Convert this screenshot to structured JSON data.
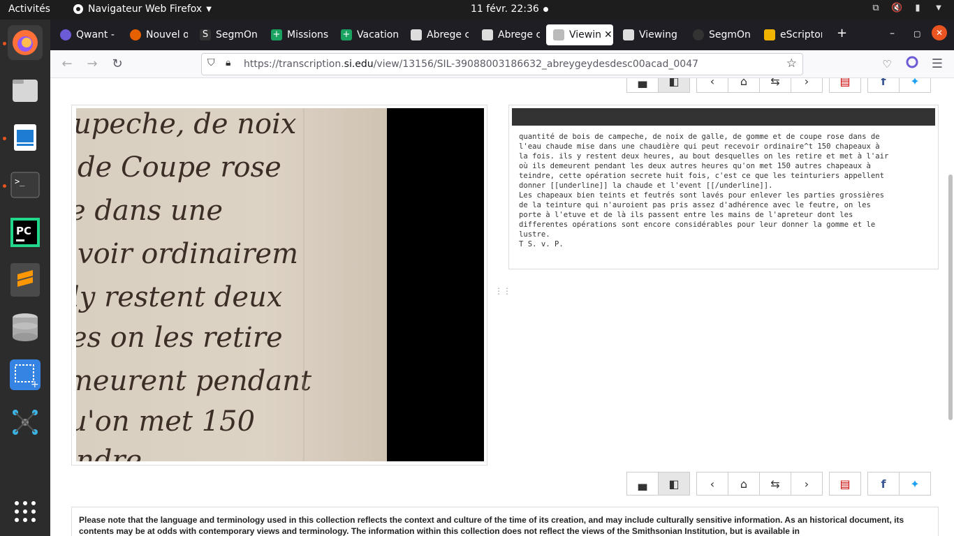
{
  "system": {
    "activities": "Activités",
    "app_menu": "Navigateur Web Firefox",
    "clock": "11 févr.  22:36"
  },
  "browser": {
    "tabs": [
      {
        "label": "Qwant -",
        "favicon_color": "#6b5bd6"
      },
      {
        "label": "Nouvel o",
        "favicon_color": "#e66000"
      },
      {
        "label": "SegmOn",
        "favicon_color": "#333333"
      },
      {
        "label": "Missions",
        "favicon_color": "#1aa260"
      },
      {
        "label": "Vacation",
        "favicon_color": "#1aa260"
      },
      {
        "label": "Abrege c",
        "favicon_color": "#dddddd"
      },
      {
        "label": "Abrege c",
        "favicon_color": "#dddddd"
      },
      {
        "label": "Viewin",
        "favicon_color": "#dddddd",
        "active": true
      },
      {
        "label": "Viewing",
        "favicon_color": "#dddddd"
      },
      {
        "label": "SegmOn",
        "favicon_color": "#333333"
      },
      {
        "label": "eScriptor",
        "favicon_color": "#f0b400"
      }
    ],
    "url_prefix": "https://transcription.",
    "url_domain": "si.edu",
    "url_path": "/view/13156/SIL-39088003186632_abreygeydesdesc00acad_0047"
  },
  "viewer": {
    "transcription": "quantité de bois de campeche, de noix de galle, de gomme et de coupe rose dans de\nl'eau chaude mise dans une chaudière qui peut recevoir ordinaire^t 150 chapeaux à\nla fois. ils y restent deux heures, au bout desquelles on les retire et met à l'air\noù ils demeurent pendant les deux autres heures qu'on met 150 autres chapeaux à\nteindre, cette opération secrete huit fois, c'est ce que les teinturiers appellent\ndonner [[underline]] la chaude et l'event [[/underline]].\nLes chapeaux bien teints et feutrés sont lavés pour enlever les parties grossières\nde la teinture qui n'auroient pas pris assez d'adhérence avec le feutre, on les\nporte à l'etuve et de là ils passent entre les mains de l'apreteur dont les\ndifferentes opérations sont encore considérables pour leur donner la gomme et le\nlustre.\nT S. v. P.",
    "manuscript_lines": [
      "upeche, de noix",
      "de Coupe rose",
      "e dans une",
      "voir ordinairem",
      "ly restent deux",
      "es on les retire",
      "meurent pendant",
      "u'on met 150",
      "ndre"
    ],
    "notice": "Please note that the language and terminology used in this collection reflects the context and culture of the time of its creation, and may include culturally sensitive information. As an historical document, its contents may be at odds with contemporary views and terminology. The information within this collection does not reflect the views of the Smithsonian Institution, but is available in"
  }
}
